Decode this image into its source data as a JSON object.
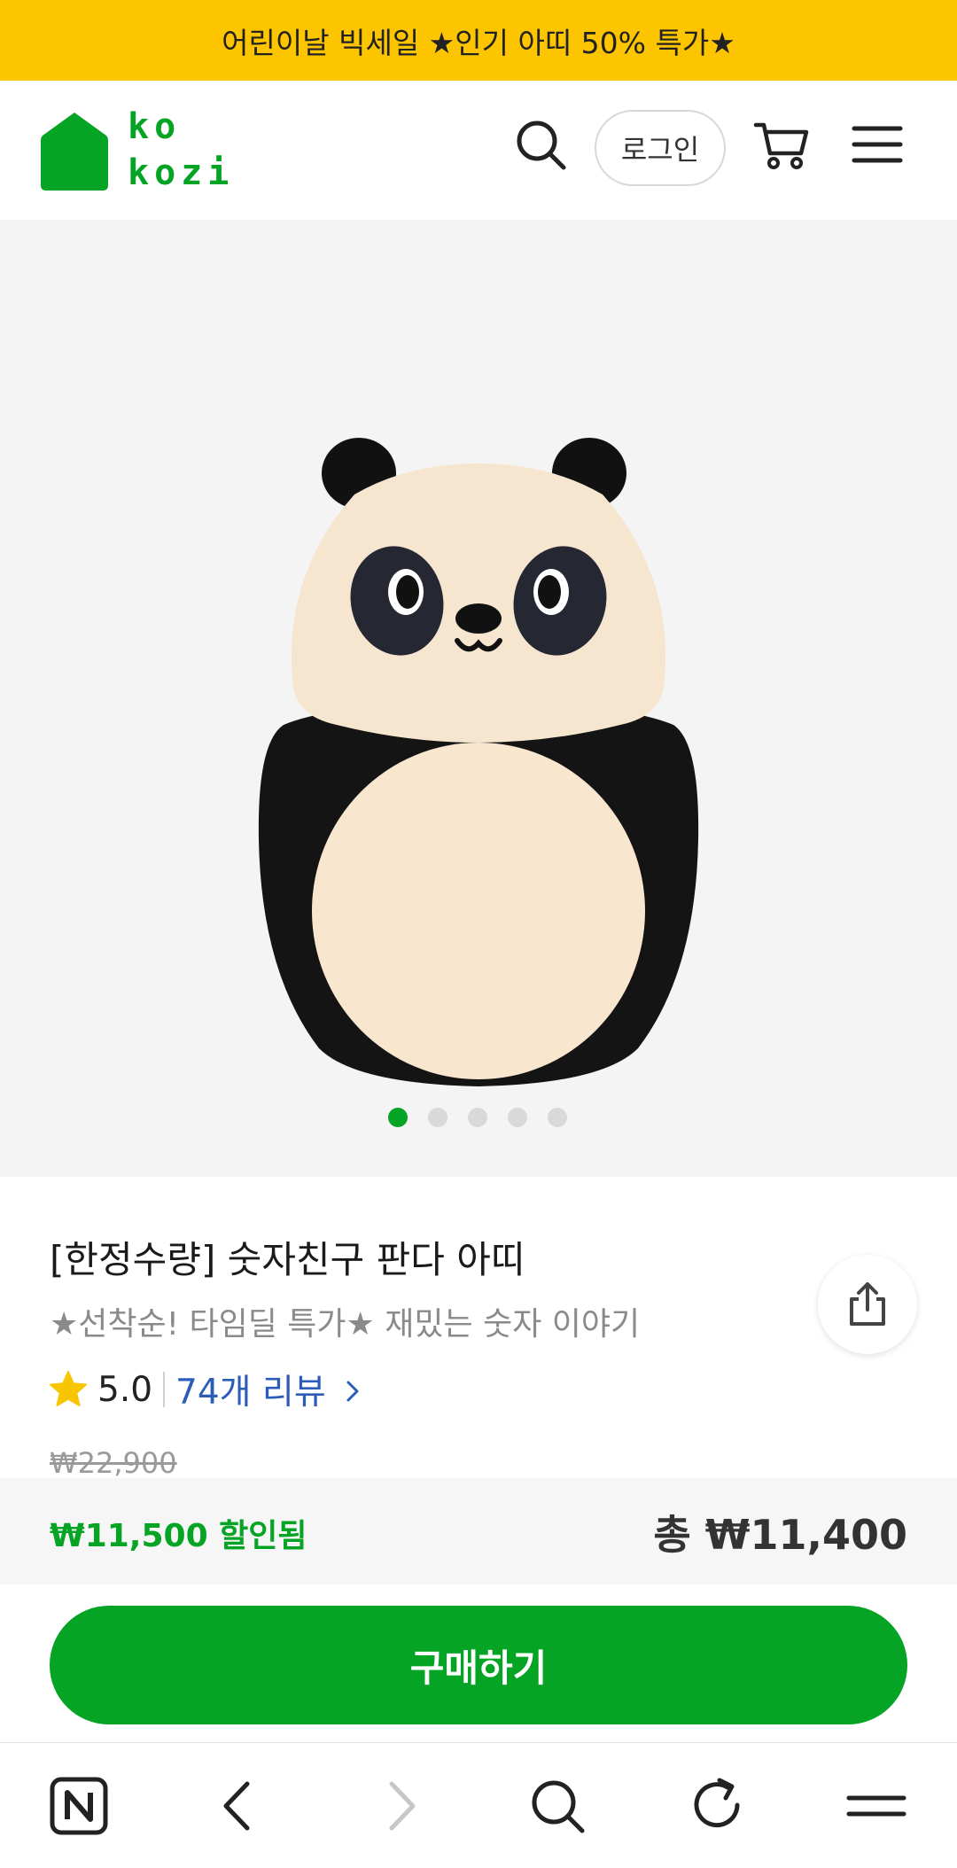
{
  "banner": {
    "text": "어린이날 빅세일 ★인기 아띠 50% 특가★"
  },
  "header": {
    "logo_top": "ko",
    "logo_bottom": "kozi",
    "login_label": "로그인",
    "icons": [
      "search-icon",
      "cart-icon",
      "menu-icon"
    ]
  },
  "gallery": {
    "slide_count": 5,
    "active_index": 0,
    "share_icon": "share-icon"
  },
  "product": {
    "title": "[한정수량] 숫자친구 판다 아띠",
    "subtitle": "★선착순! 타임딜 특가★ 재밌는 숫자 이야기",
    "rating": "5.0",
    "review_link": "74개 리뷰",
    "original_price": "₩22,900",
    "discount_text": "₩11,500 할인됨",
    "total_text": "총 ₩11,400"
  },
  "cta": {
    "buy_label": "구매하기"
  },
  "browser_bar": {
    "icons": [
      "naver-home-icon",
      "back-icon",
      "forward-icon",
      "search-icon",
      "refresh-icon",
      "menu-icon"
    ]
  },
  "colors": {
    "brand_green": "#06a424",
    "banner_yellow": "#fcc500",
    "link_blue": "#2b5cb8",
    "star_yellow": "#f7c600"
  }
}
